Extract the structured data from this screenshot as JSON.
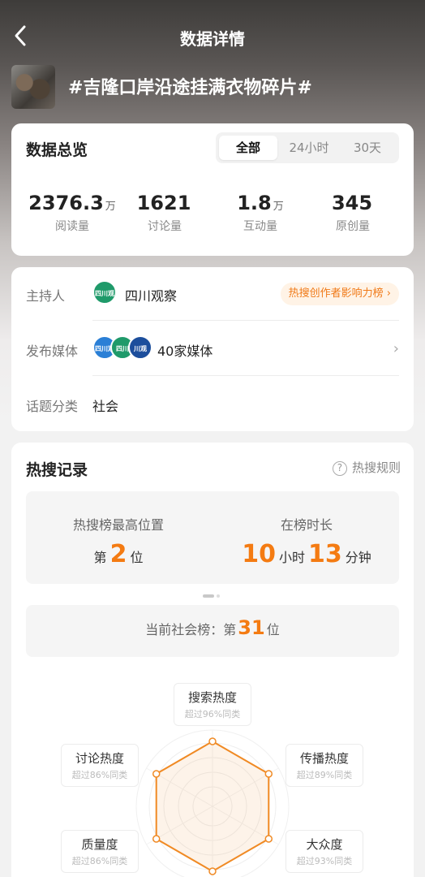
{
  "nav": {
    "title": "数据详情"
  },
  "topic": {
    "title": "#吉隆口岸沿途挂满衣物碎片#"
  },
  "overview": {
    "title": "数据总览",
    "tabs": [
      {
        "label": "全部",
        "active": true
      },
      {
        "label": "24小时"
      },
      {
        "label": "30天"
      }
    ],
    "stats": [
      {
        "value": "2376.3",
        "unit": "万",
        "label": "阅读量"
      },
      {
        "value": "1621",
        "unit": "",
        "label": "讨论量"
      },
      {
        "value": "1.8",
        "unit": "万",
        "label": "互动量"
      },
      {
        "value": "345",
        "unit": "",
        "label": "原创量"
      }
    ]
  },
  "info": {
    "host": {
      "label": "主持人",
      "avatar_text": "四川观察",
      "name": "四川观察",
      "badge": "热搜创作者影响力榜 ›"
    },
    "media": {
      "label": "发布媒体",
      "avatars": [
        "四川观察",
        "四川",
        "川观"
      ],
      "text": "40家媒体"
    },
    "category": {
      "label": "话题分类",
      "value": "社会"
    }
  },
  "hot": {
    "title": "热搜记录",
    "rules": "热搜规则",
    "peak": {
      "label": "热搜榜最高位置",
      "prefix": "第",
      "value": "2",
      "suffix": "位"
    },
    "duration": {
      "label": "在榜时长",
      "hours": "10",
      "hours_unit": "小时",
      "minutes": "13",
      "minutes_unit": "分钟"
    },
    "current": {
      "prefix": "当前社会榜：第",
      "value": "31",
      "suffix": "位"
    }
  },
  "radar": {
    "labels": [
      {
        "title": "搜索热度",
        "sub": "超过96%同类"
      },
      {
        "title": "传播热度",
        "sub": "超过89%同类"
      },
      {
        "title": "大众度",
        "sub": "超过93%同类"
      },
      {
        "title": "质量度",
        "sub": "超过86%同类"
      },
      {
        "title": "讨论热度",
        "sub": "超过86%同类"
      }
    ],
    "color": "#f08a24"
  }
}
